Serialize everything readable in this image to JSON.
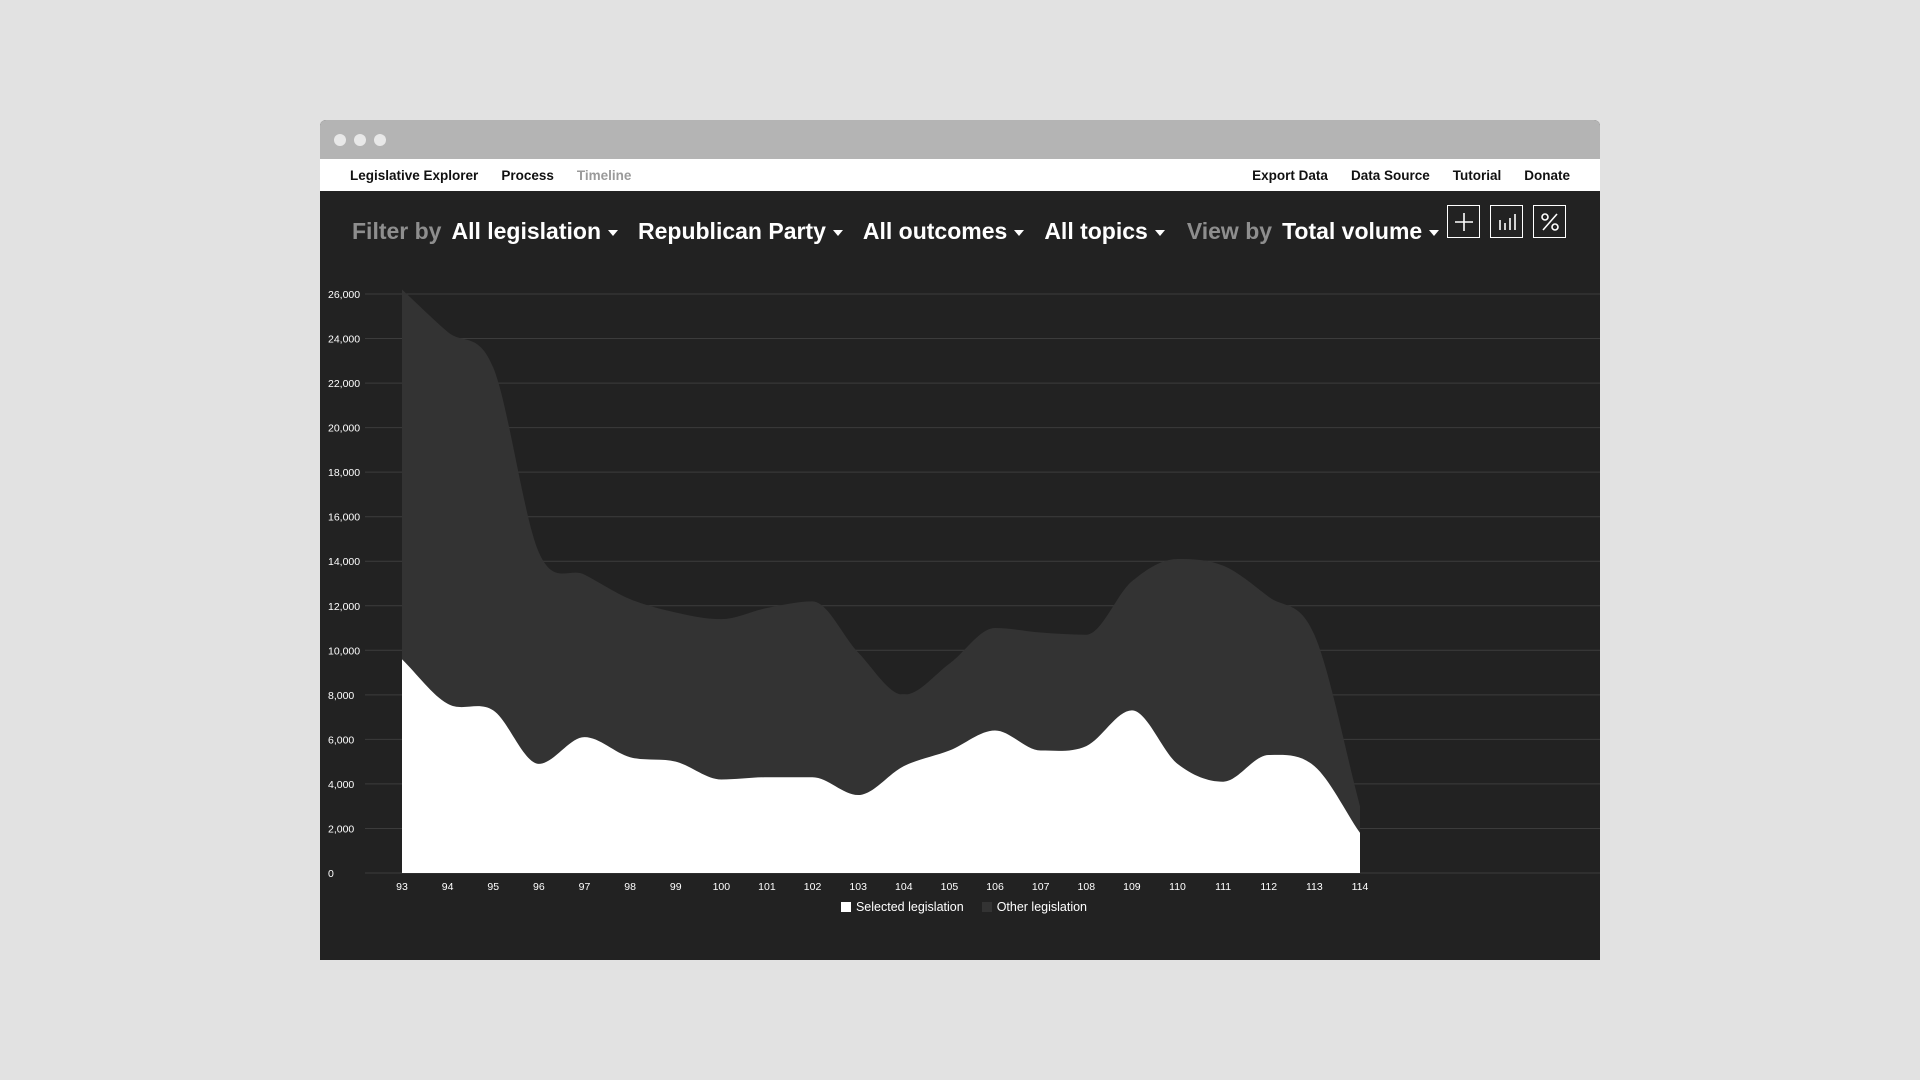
{
  "nav": {
    "left": [
      "Legislative Explorer",
      "Process",
      "Timeline"
    ],
    "right": [
      "Export Data",
      "Data Source",
      "Tutorial",
      "Donate"
    ]
  },
  "filters": {
    "filter_label": "Filter by",
    "legislation": "All legislation",
    "party": "Republican Party",
    "outcomes": "All outcomes",
    "topics": "All topics",
    "view_label": "View by",
    "view": "Total volume"
  },
  "icons": [
    "plus-icon",
    "bar-chart-icon",
    "percent-icon"
  ],
  "colors": {
    "selected": "#ffffff",
    "other": "#333333",
    "background": "#222222",
    "page": "#e2e2e2"
  },
  "chart_data": {
    "type": "area",
    "stacked": true,
    "x": [
      "93",
      "94",
      "95",
      "96",
      "97",
      "98",
      "99",
      "100",
      "101",
      "102",
      "103",
      "104",
      "105",
      "106",
      "107",
      "108",
      "109",
      "110",
      "111",
      "112",
      "113",
      "114"
    ],
    "series": [
      {
        "name": "Selected legislation",
        "values": [
          9600,
          7600,
          7300,
          4900,
          6100,
          5200,
          5000,
          4200,
          4300,
          4300,
          3500,
          4800,
          5500,
          6400,
          5500,
          5700,
          7300,
          4900,
          4100,
          5300,
          4800,
          1800
        ]
      },
      {
        "name": "Other legislation",
        "values": [
          16600,
          16700,
          15400,
          9500,
          7300,
          7100,
          6700,
          7200,
          7600,
          7900,
          6400,
          3200,
          3900,
          4600,
          5300,
          5000,
          5800,
          9200,
          9700,
          7100,
          5900,
          1200
        ]
      }
    ],
    "yticks": [
      0,
      2000,
      4000,
      6000,
      8000,
      10000,
      12000,
      14000,
      16000,
      18000,
      20000,
      22000,
      24000,
      26000
    ],
    "ytick_labels": [
      "0",
      "2,000",
      "4,000",
      "6,000",
      "8,000",
      "10,000",
      "12,000",
      "14,000",
      "16,000",
      "18,000",
      "20,000",
      "22,000",
      "24,000",
      "26,000"
    ],
    "ylim": [
      0,
      26000
    ],
    "grid": true,
    "legend": "bottom-center"
  }
}
